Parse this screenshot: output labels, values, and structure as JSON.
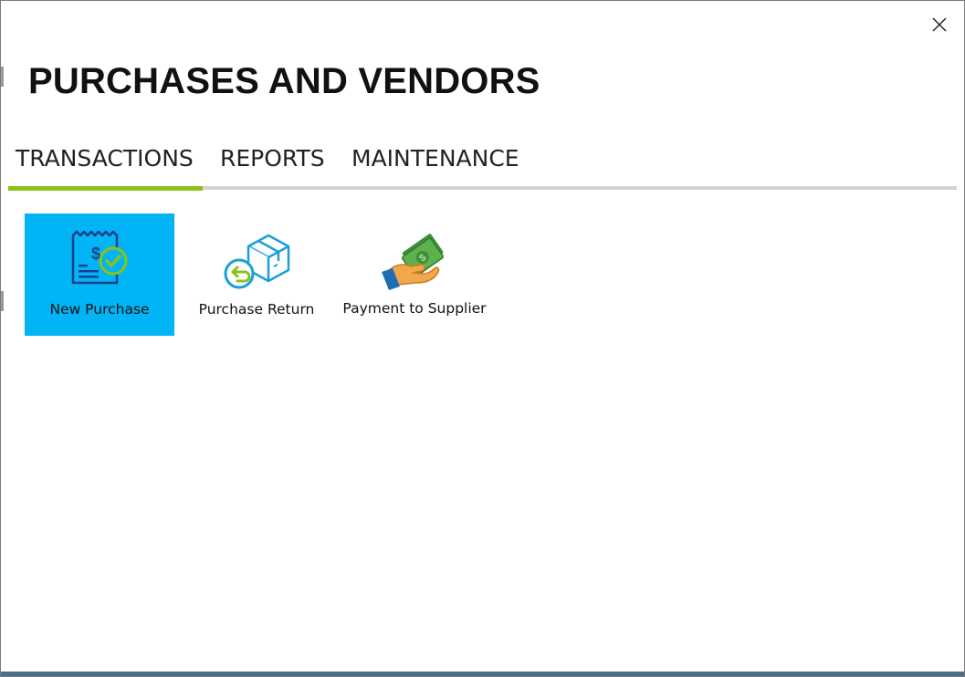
{
  "window": {
    "title": "PURCHASES AND VENDORS",
    "close_icon": "close-icon"
  },
  "tabs": [
    {
      "label": "TRANSACTIONS",
      "active": true
    },
    {
      "label": "REPORTS",
      "active": false
    },
    {
      "label": "MAINTENANCE",
      "active": false
    }
  ],
  "actions": [
    {
      "label": "New Purchase",
      "icon": "receipt-check-icon",
      "selected": true
    },
    {
      "label": "Purchase Return",
      "icon": "box-return-icon",
      "selected": false
    },
    {
      "label": "Payment to Supplier",
      "icon": "cash-hand-icon",
      "selected": false
    }
  ],
  "colors": {
    "accent_tab": "#8bc21a",
    "selected_tile": "#00b4f5",
    "bottom_bar": "#4a6f8a"
  }
}
